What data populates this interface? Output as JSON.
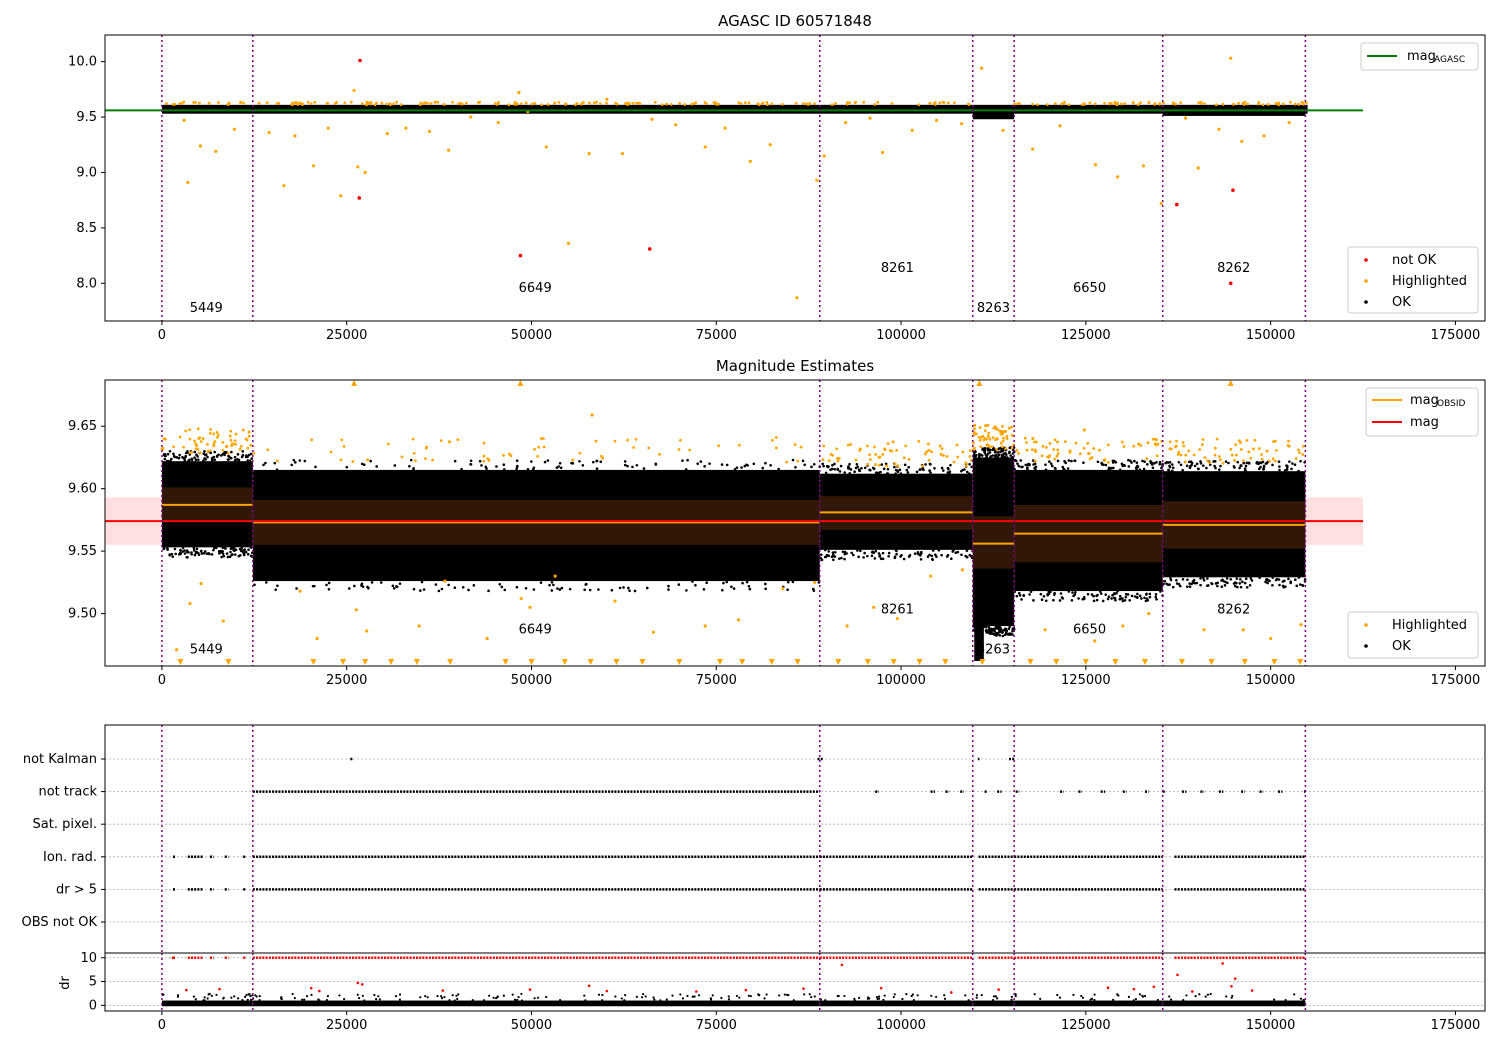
{
  "chart_data": [
    {
      "type": "scatter",
      "title": "AGASC ID 60571848",
      "xlim": [
        -7700,
        179000
      ],
      "ylim": [
        7.66,
        10.24
      ],
      "xticks": [
        0,
        25000,
        50000,
        75000,
        100000,
        125000,
        150000,
        175000
      ],
      "yticks": [
        8.0,
        8.5,
        9.0,
        9.5,
        10.0
      ],
      "ytick_labels": [
        "8.0",
        "8.5",
        "9.0",
        "9.5",
        "10.0"
      ],
      "obsid_boundaries": [
        0,
        12300,
        89000,
        109700,
        115300,
        135400,
        154700
      ],
      "obsid_labels": [
        {
          "text": "5449",
          "x": 6000,
          "y": 7.74
        },
        {
          "text": "6649",
          "x": 50500,
          "y": 7.92
        },
        {
          "text": "8261",
          "x": 99500,
          "y": 8.1
        },
        {
          "text": "8263",
          "x": 112500,
          "y": 7.74
        },
        {
          "text": "6650",
          "x": 125500,
          "y": 7.92
        },
        {
          "text": "8262",
          "x": 145000,
          "y": 8.1
        }
      ],
      "series": [
        {
          "name": "OK",
          "color": "#000000",
          "band": true
        },
        {
          "name": "Highlighted",
          "color": "#ffa500",
          "points": [
            [
              3500,
              8.91
            ],
            [
              5200,
              9.24
            ],
            [
              7300,
              9.19
            ],
            [
              16500,
              8.88
            ],
            [
              20500,
              9.06
            ],
            [
              24200,
              8.79
            ],
            [
              26000,
              9.74
            ],
            [
              26500,
              9.05
            ],
            [
              27500,
              9.0
            ],
            [
              30500,
              9.35
            ],
            [
              38800,
              9.2
            ],
            [
              48300,
              9.72
            ],
            [
              49500,
              9.55
            ],
            [
              52000,
              9.23
            ],
            [
              55000,
              8.36
            ],
            [
              57800,
              9.17
            ],
            [
              60200,
              9.66
            ],
            [
              62300,
              9.17
            ],
            [
              73500,
              9.23
            ],
            [
              79600,
              9.1
            ],
            [
              82300,
              9.25
            ],
            [
              85900,
              7.87
            ],
            [
              88600,
              8.93
            ],
            [
              89600,
              9.15
            ],
            [
              97500,
              9.18
            ],
            [
              110900,
              9.94
            ],
            [
              113800,
              9.38
            ],
            [
              117800,
              9.21
            ],
            [
              126300,
              9.07
            ],
            [
              129300,
              8.96
            ],
            [
              132800,
              9.06
            ],
            [
              135200,
              8.72
            ],
            [
              140200,
              9.04
            ],
            [
              143000,
              9.39
            ],
            [
              144600,
              10.03
            ],
            [
              146100,
              9.28
            ],
            [
              149100,
              9.33
            ],
            [
              3000,
              9.47
            ],
            [
              9800,
              9.39
            ],
            [
              14500,
              9.36
            ],
            [
              18000,
              9.33
            ],
            [
              22500,
              9.4
            ],
            [
              33000,
              9.4
            ],
            [
              36200,
              9.37
            ],
            [
              41800,
              9.5
            ],
            [
              45500,
              9.45
            ],
            [
              66300,
              9.48
            ],
            [
              69500,
              9.43
            ],
            [
              76200,
              9.4
            ],
            [
              92500,
              9.45
            ],
            [
              95800,
              9.49
            ],
            [
              101500,
              9.38
            ],
            [
              104800,
              9.47
            ],
            [
              108200,
              9.44
            ],
            [
              121500,
              9.42
            ],
            [
              138500,
              9.49
            ],
            [
              152500,
              9.45
            ]
          ]
        },
        {
          "name": "not OK",
          "color": "#ff0000",
          "points": [
            [
              26800,
              10.01
            ],
            [
              26700,
              8.77
            ],
            [
              48500,
              8.25
            ],
            [
              66000,
              8.31
            ],
            [
              137300,
              8.71
            ],
            [
              144900,
              8.84
            ],
            [
              144600,
              8.0
            ]
          ]
        }
      ],
      "mag_agasc": 9.56,
      "mag_agasc_range": [
        -7700,
        162500
      ],
      "legend_line_label": "mag",
      "legend_line_sub": "AGASC",
      "legend_scatter": [
        "not OK",
        "Highlighted",
        "OK"
      ],
      "legend_line_placement": "top-right",
      "legend_scatter_placement": "bottom-right",
      "ok_band": [
        [
          0,
          155000,
          9.53,
          9.61
        ]
      ]
    },
    {
      "type": "scatter",
      "title": "Magnitude Estimates",
      "xlim": [
        -7700,
        179000
      ],
      "ylim": [
        9.458,
        9.687
      ],
      "xticks": [
        0,
        25000,
        50000,
        75000,
        100000,
        125000,
        150000,
        175000
      ],
      "yticks": [
        9.5,
        9.55,
        9.6,
        9.65
      ],
      "ytick_labels": [
        "9.50",
        "9.55",
        "9.60",
        "9.65"
      ],
      "obsid_boundaries": [
        0,
        12300,
        89000,
        109700,
        115300,
        135400,
        154700
      ],
      "obsid_labels": [
        {
          "text": "5449",
          "x": 6000,
          "y": 9.468
        },
        {
          "text": "6649",
          "x": 50500,
          "y": 9.484
        },
        {
          "text": "8261",
          "x": 99500,
          "y": 9.5
        },
        {
          "text": "8263",
          "x": 112500,
          "y": 9.468
        },
        {
          "text": "6650",
          "x": 125500,
          "y": 9.484
        },
        {
          "text": "8262",
          "x": 145000,
          "y": 9.5
        }
      ],
      "mag": 9.574,
      "mag_band": [
        9.555,
        9.593
      ],
      "mag_range": [
        -7700,
        162500
      ],
      "obsid_mags": [
        {
          "start": 0,
          "end": 12300,
          "mag": 9.587,
          "low": 9.574,
          "high": 9.601,
          "ok_low": 9.553,
          "ok_high": 9.622
        },
        {
          "start": 12300,
          "end": 89000,
          "mag": 9.573,
          "low": 9.555,
          "high": 9.591,
          "ok_low": 9.526,
          "ok_high": 9.615
        },
        {
          "start": 89000,
          "end": 109700,
          "mag": 9.581,
          "low": 9.567,
          "high": 9.594,
          "ok_low": 9.551,
          "ok_high": 9.612
        },
        {
          "start": 109700,
          "end": 115300,
          "mag": 9.556,
          "low": 9.536,
          "high": 9.578,
          "ok_low": 9.49,
          "ok_high": 9.625
        },
        {
          "start": 115300,
          "end": 135400,
          "mag": 9.564,
          "low": 9.541,
          "high": 9.587,
          "ok_low": 9.518,
          "ok_high": 9.615
        },
        {
          "start": 135400,
          "end": 154700,
          "mag": 9.571,
          "low": 9.552,
          "high": 9.59,
          "ok_low": 9.529,
          "ok_high": 9.614
        }
      ],
      "highlighted_clipped_x": [
        2500,
        9000,
        20500,
        24500,
        27500,
        31000,
        34500,
        39000,
        46500,
        50000,
        54500,
        58000,
        61500,
        65000,
        70000,
        75500,
        78500,
        82500,
        86000,
        91500,
        95500,
        99000,
        102500,
        106000,
        111000,
        117500,
        121000,
        125000,
        129000,
        133000,
        138000,
        142000,
        146500,
        150500,
        154000
      ],
      "highlighted_top_x": [
        26000,
        48500,
        110600,
        144600
      ],
      "highlighted_points": [
        [
          2000,
          9.471
        ],
        [
          3800,
          9.508
        ],
        [
          5300,
          9.524
        ],
        [
          8300,
          9.494
        ],
        [
          18700,
          9.518
        ],
        [
          21000,
          9.48
        ],
        [
          26300,
          9.503
        ],
        [
          27700,
          9.486
        ],
        [
          34800,
          9.49
        ],
        [
          48600,
          9.512
        ],
        [
          49800,
          9.505
        ],
        [
          53200,
          9.53
        ],
        [
          58200,
          9.659
        ],
        [
          66500,
          9.485
        ],
        [
          73500,
          9.49
        ],
        [
          78000,
          9.495
        ],
        [
          92700,
          9.49
        ],
        [
          96300,
          9.505
        ],
        [
          99500,
          9.496
        ],
        [
          104000,
          9.53
        ],
        [
          108300,
          9.535
        ],
        [
          113000,
          9.64
        ],
        [
          119500,
          9.487
        ],
        [
          124800,
          9.647
        ],
        [
          126200,
          9.478
        ],
        [
          130000,
          9.49
        ],
        [
          133500,
          9.5
        ],
        [
          141000,
          9.487
        ],
        [
          146300,
          9.487
        ],
        [
          150000,
          9.48
        ],
        [
          154100,
          9.491
        ],
        [
          38300,
          9.526
        ],
        [
          44000,
          9.48
        ],
        [
          61300,
          9.51
        ],
        [
          84000,
          9.52
        ],
        [
          88300,
          9.525
        ]
      ],
      "legend_line_entries": [
        "mag",
        "mag"
      ],
      "legend_line_sub": "OBSID",
      "legend_scatter": [
        "Highlighted",
        "OK"
      ],
      "legend_line_placement": "top-right",
      "legend_scatter_placement": "bottom-right"
    },
    {
      "type": "scatter",
      "xlim": [
        -7700,
        179000
      ],
      "xticks": [
        0,
        25000,
        50000,
        75000,
        100000,
        125000,
        150000,
        175000
      ],
      "flag_rows": [
        "not Kalman",
        "not track",
        "Sat. pixel.",
        "Ion. rad.",
        "dr > 5",
        "OBS not OK"
      ],
      "flag_segments": [
        {
          "flag": "not track",
          "ranges": [
            [
              12300,
              89000
            ],
            [
              96500,
              97000
            ],
            [
              104000,
              104600
            ],
            [
              106000,
              106500
            ],
            [
              108000,
              108500
            ],
            [
              111300,
              111600
            ],
            [
              113000,
              113600
            ],
            [
              115500,
              116000
            ],
            [
              121500,
              122000
            ],
            [
              124000,
              124500
            ],
            [
              127000,
              127600
            ],
            [
              130000,
              130500
            ],
            [
              133000,
              133500
            ],
            [
              135400,
              135700
            ],
            [
              138000,
              138600
            ],
            [
              140500,
              141000
            ],
            [
              143000,
              143600
            ],
            [
              146000,
              146500
            ],
            [
              148500,
              149000
            ],
            [
              151000,
              151600
            ],
            [
              154500,
              154700
            ]
          ]
        },
        {
          "flag": "Ion. rad.",
          "ranges": [
            [
              1500,
              1800
            ],
            [
              3500,
              5500
            ],
            [
              6500,
              7000
            ],
            [
              8500,
              9000
            ],
            [
              11000,
              11300
            ],
            [
              12300,
              89000
            ],
            [
              89000,
              109700
            ],
            [
              110500,
              115300
            ],
            [
              115300,
              135400
            ],
            [
              137000,
              154700
            ]
          ]
        },
        {
          "flag": "dr > 5",
          "ranges": [
            [
              1500,
              1800
            ],
            [
              3500,
              5500
            ],
            [
              6500,
              7000
            ],
            [
              8500,
              9000
            ],
            [
              11000,
              11300
            ],
            [
              12300,
              89000
            ],
            [
              89000,
              109700
            ],
            [
              110500,
              115300
            ],
            [
              115300,
              135400
            ],
            [
              137000,
              154700
            ]
          ]
        },
        {
          "flag": "not Kalman",
          "ranges": [
            [
              25500,
              25800
            ],
            [
              88700,
              89500
            ],
            [
              110400,
              110600
            ],
            [
              114600,
              115300
            ]
          ]
        }
      ],
      "dr": {
        "ylabel": "dr",
        "yticks": [
          0,
          5,
          10
        ],
        "ylim": [
          -1.2,
          11.0
        ],
        "capped_value": 10,
        "capped_ranges": [
          [
            1500,
            1800
          ],
          [
            3500,
            5500
          ],
          [
            6500,
            7000
          ],
          [
            8500,
            9000
          ],
          [
            11000,
            11300
          ],
          [
            12300,
            89000
          ],
          [
            89000,
            109700
          ],
          [
            110500,
            115300
          ],
          [
            115300,
            135400
          ],
          [
            137000,
            154700
          ]
        ],
        "outliers": [
          [
            3300,
            3.2
          ],
          [
            7800,
            3.4
          ],
          [
            20200,
            3.6
          ],
          [
            21300,
            3.0
          ],
          [
            26500,
            4.7
          ],
          [
            27100,
            4.4
          ],
          [
            38000,
            3.1
          ],
          [
            49800,
            3.3
          ],
          [
            57800,
            4.1
          ],
          [
            60200,
            3.0
          ],
          [
            72300,
            2.9
          ],
          [
            79000,
            3.2
          ],
          [
            86800,
            3.5
          ],
          [
            92000,
            8.5
          ],
          [
            97300,
            3.6
          ],
          [
            106800,
            2.7
          ],
          [
            113200,
            3.3
          ],
          [
            128000,
            3.7
          ],
          [
            131500,
            3.4
          ],
          [
            134200,
            3.9
          ],
          [
            137400,
            6.4
          ],
          [
            139400,
            2.9
          ],
          [
            143500,
            8.8
          ],
          [
            144700,
            4.0
          ],
          [
            145200,
            5.6
          ],
          [
            147500,
            3.1
          ],
          [
            1500,
            10.0
          ]
        ]
      }
    }
  ]
}
